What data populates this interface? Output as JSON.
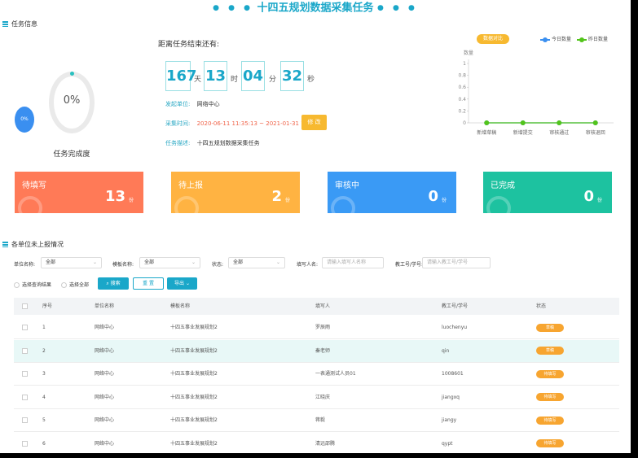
{
  "page_title": "十四五规划数据采集任务",
  "section_task": "任务信息",
  "progress": {
    "percent_text": "0%",
    "bubble_text": "0%",
    "label": "任务完成度",
    "value": 0
  },
  "countdown": {
    "label": "距离任务结束还有:",
    "days": "167",
    "days_unit": "天",
    "hours": "13",
    "hours_unit": "时",
    "minutes": "04",
    "minutes_unit": "分",
    "seconds": "32",
    "seconds_unit": "秒"
  },
  "task_info": {
    "issuer_key": "发起单位:",
    "issuer_value": "网络中心",
    "period_key": "采集时间:",
    "period_value": "2020-06-11 11:35:13 ~ 2021-01-31 11:35:13",
    "edit_button": "修 改",
    "desc_key": "任务描述:",
    "desc_value": "十四五规划数据采集任务"
  },
  "status_cards": [
    {
      "label": "待填写",
      "count": "13",
      "unit": "份",
      "color": "#ff7a57"
    },
    {
      "label": "待上报",
      "count": "2",
      "unit": "份",
      "color": "#ffb342"
    },
    {
      "label": "审核中",
      "count": "0",
      "unit": "份",
      "color": "#3a9af5"
    },
    {
      "label": "已完成",
      "count": "0",
      "unit": "份",
      "color": "#1dc2a0"
    }
  ],
  "chart_tag": "数据对比",
  "chart_data": {
    "type": "line",
    "categories": [
      "新增草稿",
      "新增提交",
      "审核通过",
      "审核退回"
    ],
    "series": [
      {
        "name": "今日数量",
        "values": [
          0,
          0,
          0,
          0
        ],
        "color": "#3a8ff0"
      },
      {
        "name": "昨日数量",
        "values": [
          0,
          0,
          0,
          0
        ],
        "color": "#52c41a"
      }
    ],
    "ylabel": "数量",
    "ylim": [
      0,
      1
    ],
    "yticks": [
      "0",
      "0.2",
      "0.4",
      "0.6",
      "0.8",
      "1"
    ]
  },
  "section_report": "各单位未上报情况",
  "filters": {
    "unit_label": "单位名称:",
    "unit_value": "全部",
    "template_label": "模板名称:",
    "template_value": "全部",
    "status_label": "状态:",
    "status_value": "全部",
    "filler_label": "填写人名:",
    "filler_placeholder": "请输入填写人名称",
    "staff_label": "教工号/学号:",
    "staff_placeholder": "请输入教工号/学号"
  },
  "actions": {
    "select_result": "选择查询结果",
    "select_all": "选择全部",
    "search": "搜索",
    "reset": "重 置",
    "export": "导出"
  },
  "table": {
    "headers": [
      "序号",
      "单位名称",
      "模板名称",
      "填写人",
      "教工号/学号",
      "状态"
    ],
    "rows": [
      {
        "no": "1",
        "unit": "网络中心",
        "template": "十四五事业发展规划2",
        "filler": "罗辰雨",
        "id": "luochenyu",
        "status": "草稿"
      },
      {
        "no": "2",
        "unit": "网络中心",
        "template": "十四五事业发展规划2",
        "filler": "秦老师",
        "id": "qin",
        "status": "草稿"
      },
      {
        "no": "3",
        "unit": "网络中心",
        "template": "十四五事业发展规划2",
        "filler": "一表通测试人员01",
        "id": "1008601",
        "status": "待填写"
      },
      {
        "no": "4",
        "unit": "网络中心",
        "template": "十四五事业发展规划2",
        "filler": "江晓庆",
        "id": "jiangxq",
        "status": "待填写"
      },
      {
        "no": "5",
        "unit": "网络中心",
        "template": "十四五事业发展规划2",
        "filler": "蒋毅",
        "id": "jiangy",
        "status": "待填写"
      },
      {
        "no": "6",
        "unit": "网络中心",
        "template": "十四五事业发展规划2",
        "filler": "清远邵腾",
        "id": "qypt",
        "status": "待填写"
      }
    ]
  }
}
